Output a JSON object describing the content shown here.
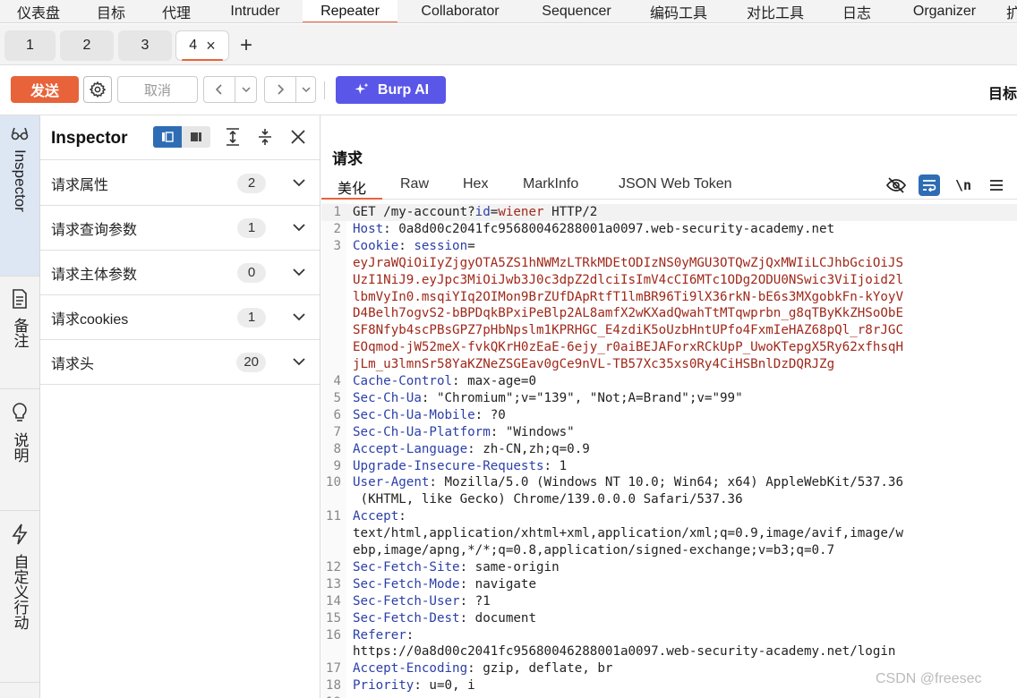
{
  "top_menu": [
    "仪表盘",
    "目标",
    "代理",
    "Intruder",
    "Repeater",
    "Collaborator",
    "Sequencer",
    "编码工具",
    "对比工具",
    "日志",
    "Organizer",
    "扩"
  ],
  "active_top": "Repeater",
  "tabs": [
    {
      "label": "1"
    },
    {
      "label": "2"
    },
    {
      "label": "3"
    },
    {
      "label": "4",
      "close": "×"
    }
  ],
  "new_tab": "+",
  "toolbar": {
    "send": "发送",
    "cancel": "取消",
    "burp_ai": "Burp AI",
    "target": "目标"
  },
  "rail": [
    "Inspector",
    "备注",
    "说明",
    "自定义行动"
  ],
  "inspector": {
    "title": "Inspector",
    "rows": [
      {
        "label": "请求属性",
        "count": "2"
      },
      {
        "label": "请求查询参数",
        "count": "1"
      },
      {
        "label": "请求主体参数",
        "count": "0"
      },
      {
        "label": "请求cookies",
        "count": "1"
      },
      {
        "label": "请求头",
        "count": "20"
      }
    ]
  },
  "request": {
    "title": "请求",
    "subtabs": [
      "美化",
      "Raw",
      "Hex",
      "MarkInfo",
      "JSON Web Token"
    ],
    "active_subtab": "美化",
    "lines": [
      {
        "n": "1",
        "parts": [
          [
            "",
            "GET /my-account?"
          ],
          [
            "kw",
            "id"
          ],
          [
            "",
            "="
          ],
          [
            "rv",
            "wiener"
          ],
          [
            "",
            " HTTP/2"
          ]
        ],
        "hl": true
      },
      {
        "n": "2",
        "parts": [
          [
            "hn",
            "Host"
          ],
          [
            "",
            ": 0a8d00c2041fc95680046288001a0097.web-security-academy.net"
          ]
        ]
      },
      {
        "n": "3",
        "parts": [
          [
            "hn",
            "Cookie"
          ],
          [
            "",
            ": "
          ],
          [
            "kw",
            "session"
          ],
          [
            "",
            "="
          ]
        ]
      },
      {
        "n": "",
        "parts": [
          [
            "rv",
            "eyJraWQiOiIyZjgyOTA5ZS1hNWMzLTRkMDEtODIzNS0yMGU3OTQwZjQxMWIiLCJhbGciOiJS"
          ]
        ]
      },
      {
        "n": "",
        "parts": [
          [
            "rv",
            "UzI1NiJ9.eyJpc3MiOiJwb3J0c3dpZ2dlciIsImV4cCI6MTc1ODg2ODU0NSwic3ViIjoid2l"
          ]
        ]
      },
      {
        "n": "",
        "parts": [
          [
            "rv",
            "lbmVyIn0.msqiYIq2OIMon9BrZUfDApRtfT1lmBR96Ti9lX36rkN-bE6s3MXgobkFn-kYoyV"
          ]
        ]
      },
      {
        "n": "",
        "parts": [
          [
            "rv",
            "D4Belh7ogvS2-bBPDqkBPxiPeBlp2AL8amfX2wKXadQwahTtMTqwprbn_g8qTByKkZHSoObE"
          ]
        ]
      },
      {
        "n": "",
        "parts": [
          [
            "rv",
            "SF8Nfyb4scPBsGPZ7pHbNpslm1KPRHGC_E4zdiK5oUzbHntUPfo4FxmIeHAZ68pQl_r8rJGC"
          ]
        ]
      },
      {
        "n": "",
        "parts": [
          [
            "rv",
            "EOqmod-jW52meX-fvkQKrH0zEaE-6ejy_r0aiBEJAForxRCkUpP_UwoKTepgX5Ry62xfhsqH"
          ]
        ]
      },
      {
        "n": "",
        "parts": [
          [
            "rv",
            "jLm_u3lmnSr58YaKZNeZSGEav0gCe9nVL-TB57Xc35xs0Ry4CiHSBnlDzDQRJZg"
          ]
        ]
      },
      {
        "n": "4",
        "parts": [
          [
            "hn",
            "Cache-Control"
          ],
          [
            "",
            ": max-age=0"
          ]
        ]
      },
      {
        "n": "5",
        "parts": [
          [
            "hn",
            "Sec-Ch-Ua"
          ],
          [
            "",
            ": \"Chromium\";v=\"139\", \"Not;A=Brand\";v=\"99\""
          ]
        ]
      },
      {
        "n": "6",
        "parts": [
          [
            "hn",
            "Sec-Ch-Ua-Mobile"
          ],
          [
            "",
            ": ?0"
          ]
        ]
      },
      {
        "n": "7",
        "parts": [
          [
            "hn",
            "Sec-Ch-Ua-Platform"
          ],
          [
            "",
            ": \"Windows\""
          ]
        ]
      },
      {
        "n": "8",
        "parts": [
          [
            "hn",
            "Accept-Language"
          ],
          [
            "",
            ": zh-CN,zh;q=0.9"
          ]
        ]
      },
      {
        "n": "9",
        "parts": [
          [
            "hn",
            "Upgrade-Insecure-Requests"
          ],
          [
            "",
            ": 1"
          ]
        ]
      },
      {
        "n": "10",
        "parts": [
          [
            "hn",
            "User-Agent"
          ],
          [
            "",
            ": Mozilla/5.0 (Windows NT 10.0; Win64; x64) AppleWebKit/537.36"
          ]
        ]
      },
      {
        "n": "",
        "parts": [
          [
            "",
            " (KHTML, like Gecko) Chrome/139.0.0.0 Safari/537.36"
          ]
        ]
      },
      {
        "n": "11",
        "parts": [
          [
            "hn",
            "Accept"
          ],
          [
            "",
            ":"
          ]
        ]
      },
      {
        "n": "",
        "parts": [
          [
            "",
            "text/html,application/xhtml+xml,application/xml;q=0.9,image/avif,image/w"
          ]
        ]
      },
      {
        "n": "",
        "parts": [
          [
            "",
            "ebp,image/apng,*/*;q=0.8,application/signed-exchange;v=b3;q=0.7"
          ]
        ]
      },
      {
        "n": "12",
        "parts": [
          [
            "hn",
            "Sec-Fetch-Site"
          ],
          [
            "",
            ": same-origin"
          ]
        ]
      },
      {
        "n": "13",
        "parts": [
          [
            "hn",
            "Sec-Fetch-Mode"
          ],
          [
            "",
            ": navigate"
          ]
        ]
      },
      {
        "n": "14",
        "parts": [
          [
            "hn",
            "Sec-Fetch-User"
          ],
          [
            "",
            ": ?1"
          ]
        ]
      },
      {
        "n": "15",
        "parts": [
          [
            "hn",
            "Sec-Fetch-Dest"
          ],
          [
            "",
            ": document"
          ]
        ]
      },
      {
        "n": "16",
        "parts": [
          [
            "hn",
            "Referer"
          ],
          [
            "",
            ":"
          ]
        ]
      },
      {
        "n": "",
        "parts": [
          [
            "",
            "https://0a8d00c2041fc95680046288001a0097.web-security-academy.net/login"
          ]
        ]
      },
      {
        "n": "17",
        "parts": [
          [
            "hn",
            "Accept-Encoding"
          ],
          [
            "",
            ": gzip, deflate, br"
          ]
        ]
      },
      {
        "n": "18",
        "parts": [
          [
            "hn",
            "Priority"
          ],
          [
            "",
            ": u=0, i"
          ]
        ]
      },
      {
        "n": "19",
        "parts": []
      }
    ]
  },
  "watermark": "CSDN @freesec",
  "colors": {
    "accent": "#e8633a",
    "ai": "#5a56e8",
    "header_name": "#2b3fa8",
    "value": "#a0281a",
    "toggle": "#2e6db4"
  }
}
